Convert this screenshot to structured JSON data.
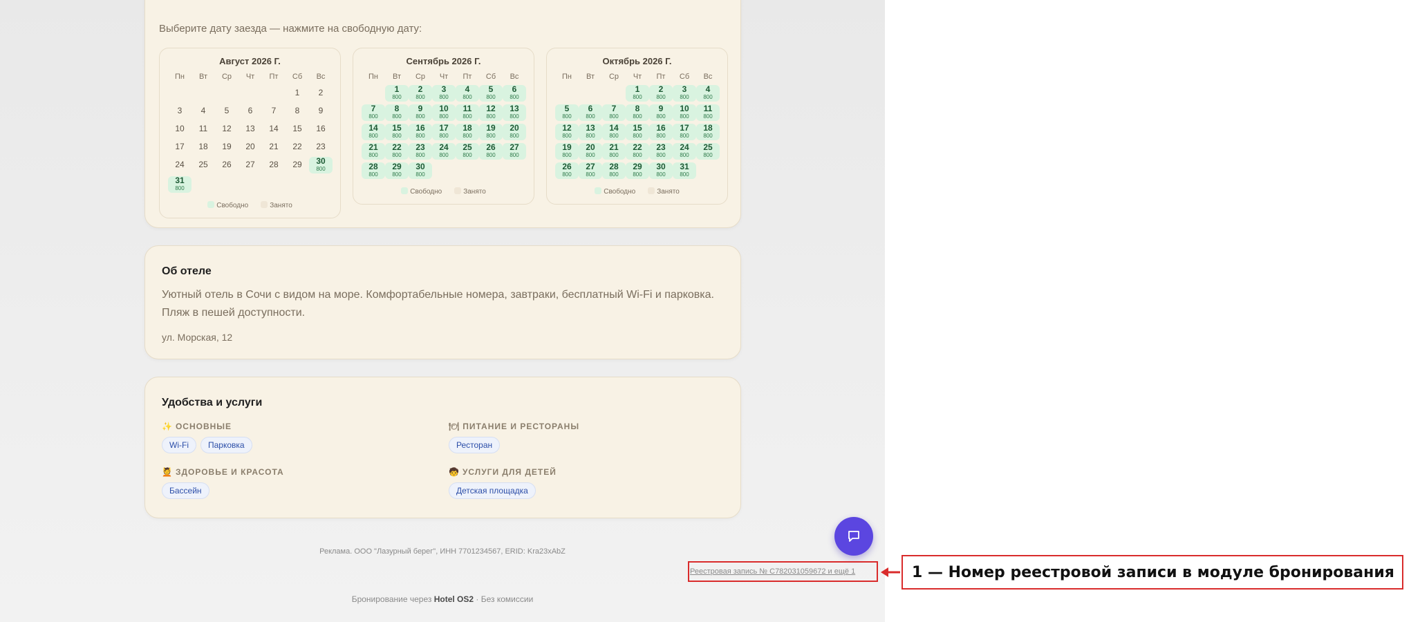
{
  "calendar": {
    "prompt": "Выберите дату заезда — нажмите на свободную дату:",
    "weekdays": [
      "Пн",
      "Вт",
      "Ср",
      "Чт",
      "Пт",
      "Сб",
      "Вс"
    ],
    "legend_free": "Свободно",
    "legend_busy": "Занято",
    "price": "800",
    "months": [
      {
        "title": "Август 2026 Г.",
        "offset": 5,
        "days": 31,
        "free_days": [
          30,
          31
        ]
      },
      {
        "title": "Сентябрь 2026 Г.",
        "offset": 1,
        "days": 30,
        "free_days": [
          1,
          2,
          3,
          4,
          5,
          6,
          7,
          8,
          9,
          10,
          11,
          12,
          13,
          14,
          15,
          16,
          17,
          18,
          19,
          20,
          21,
          22,
          23,
          24,
          25,
          26,
          27,
          28,
          29,
          30
        ]
      },
      {
        "title": "Октябрь 2026 Г.",
        "offset": 3,
        "days": 31,
        "free_days": [
          1,
          2,
          3,
          4,
          5,
          6,
          7,
          8,
          9,
          10,
          11,
          12,
          13,
          14,
          15,
          16,
          17,
          18,
          19,
          20,
          21,
          22,
          23,
          24,
          25,
          26,
          27,
          28,
          29,
          30,
          31
        ]
      }
    ]
  },
  "about": {
    "title": "Об отеле",
    "text": "Уютный отель в Сочи с видом на море. Комфортабельные номера, завтраки, бесплатный Wi-Fi и парковка. Пляж в пешей доступности.",
    "address": "ул. Морская, 12"
  },
  "amenities": {
    "title": "Удобства и услуги",
    "groups": [
      {
        "icon": "✨",
        "title": "Основные",
        "items": [
          "Wi-Fi",
          "Парковка"
        ]
      },
      {
        "icon": "🍽",
        "title": "Питание и рестораны",
        "items": [
          "Ресторан"
        ]
      },
      {
        "icon": "💆",
        "title": "Здоровье и красота",
        "items": [
          "Бассейн"
        ]
      },
      {
        "icon": "🧒",
        "title": "Услуги для детей",
        "items": [
          "Детская площадка"
        ]
      }
    ]
  },
  "footer": {
    "ad": "Реклама. ООО \"Лазурный берег\", ИНН 7701234567, ERID: Kra23xAbZ",
    "registry": "Реестровая запись № C782031059672 и ещё 1",
    "powered_prefix": "Бронирование через",
    "powered_brand": "Hotel OS2",
    "powered_suffix": "· Без комиссии"
  },
  "annotation": {
    "label": "1 — Номер реестровой записи в модуле бронирования",
    "color": "#d92b2b"
  },
  "colors": {
    "accent": "#5b46e0",
    "free_day": "#d9f3e0",
    "card_bg": "#f8f2e5",
    "chip_text": "#2c4ea8"
  }
}
